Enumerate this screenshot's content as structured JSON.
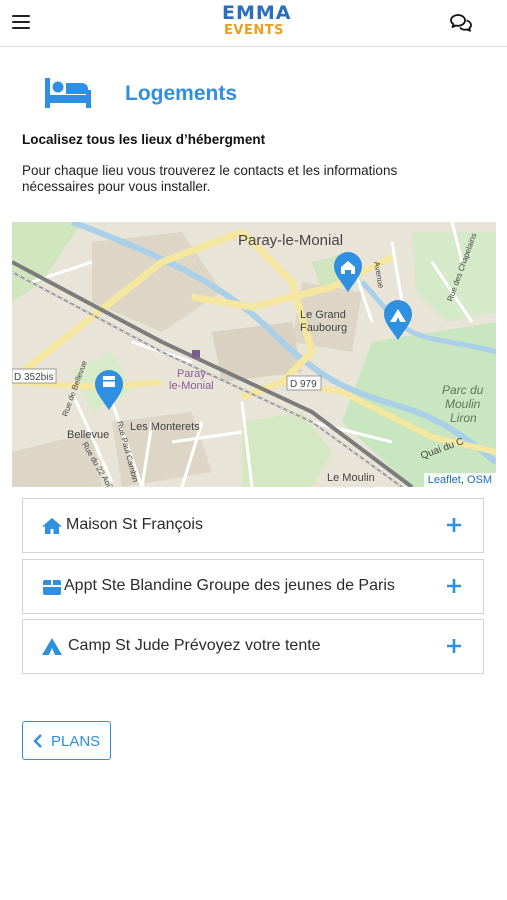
{
  "header": {
    "logo_line1": "EMMA",
    "logo_line2": "EVENTS",
    "menu_icon": "hamburger-menu-icon",
    "chat_icon": "chat-bubbles-icon"
  },
  "page": {
    "icon": "bed-icon",
    "title": "Logements",
    "subtitle": "Localisez tous les lieux d’hébergment",
    "description": "Pour chaque lieu vous trouverez le contacts et les informations nécessaires pour vous installer."
  },
  "map": {
    "labels": {
      "town": "Paray-le-Monial",
      "le_grand": "Le Grand",
      "faubourg": "Faubourg",
      "station_1": "Paray-",
      "station_2": "le-Monial",
      "d979": "D 979",
      "d352": "D 352bis",
      "parc_1": "Parc du",
      "parc_2": "Moulin",
      "parc_3": "Liron",
      "bellevue": "Bellevue",
      "monterets": "Les Monterets",
      "le_moulin": "Le Moulin",
      "quai": "Quai du C",
      "rue_bellevue": "Rue de Bellevue",
      "rue_cambin": "Rue Paul Cambin",
      "rue_aout": "Rue du 22 Août",
      "av": "Avenue",
      "rue_chapelains": "Rue des Chapelains"
    },
    "attribution": {
      "leaflet": "Leaflet",
      "sep": ", ",
      "osm": "OSM"
    },
    "markers": [
      "home-marker-icon",
      "tent-marker-icon",
      "building-marker-icon"
    ]
  },
  "accommodations": [
    {
      "icon": "home-icon",
      "label": "Maison St François"
    },
    {
      "icon": "building-icon",
      "label": "Appt Ste Blandine Groupe des jeunes de Paris"
    },
    {
      "icon": "tent-icon",
      "label": "Camp St Jude Prévoyez votre tente"
    }
  ],
  "back_button": {
    "label": "PLANS",
    "icon": "chevron-left-icon"
  },
  "colors": {
    "accent": "#2f8fe0",
    "logo_blue": "#2a6ebd",
    "logo_orange": "#e6a21e"
  }
}
